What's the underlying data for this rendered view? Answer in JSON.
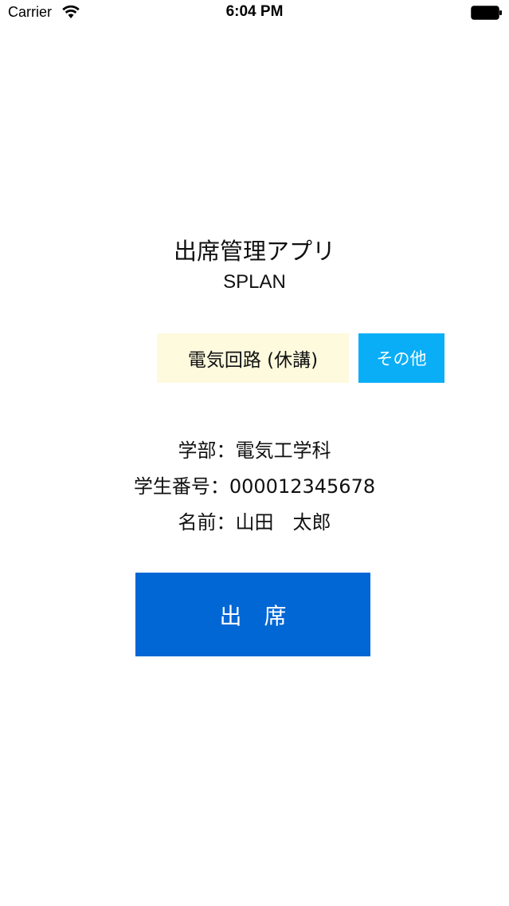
{
  "status_bar": {
    "carrier": "Carrier",
    "time": "6:04 PM",
    "wifi_icon": "wifi-icon",
    "battery_icon": "battery-icon"
  },
  "header": {
    "title": "出席管理アプリ",
    "subtitle": "SPLAN"
  },
  "class_selector": {
    "label": "電気回路 (休講)",
    "background": "#fdfadd"
  },
  "other_button": {
    "label": "その他",
    "background": "#0aaef7"
  },
  "student": {
    "department": "学部：電気工学科",
    "student_id": "学生番号：000012345678",
    "name": "名前：山田　太郎"
  },
  "attend_button": {
    "label": "出　席",
    "background": "#0067d4"
  }
}
